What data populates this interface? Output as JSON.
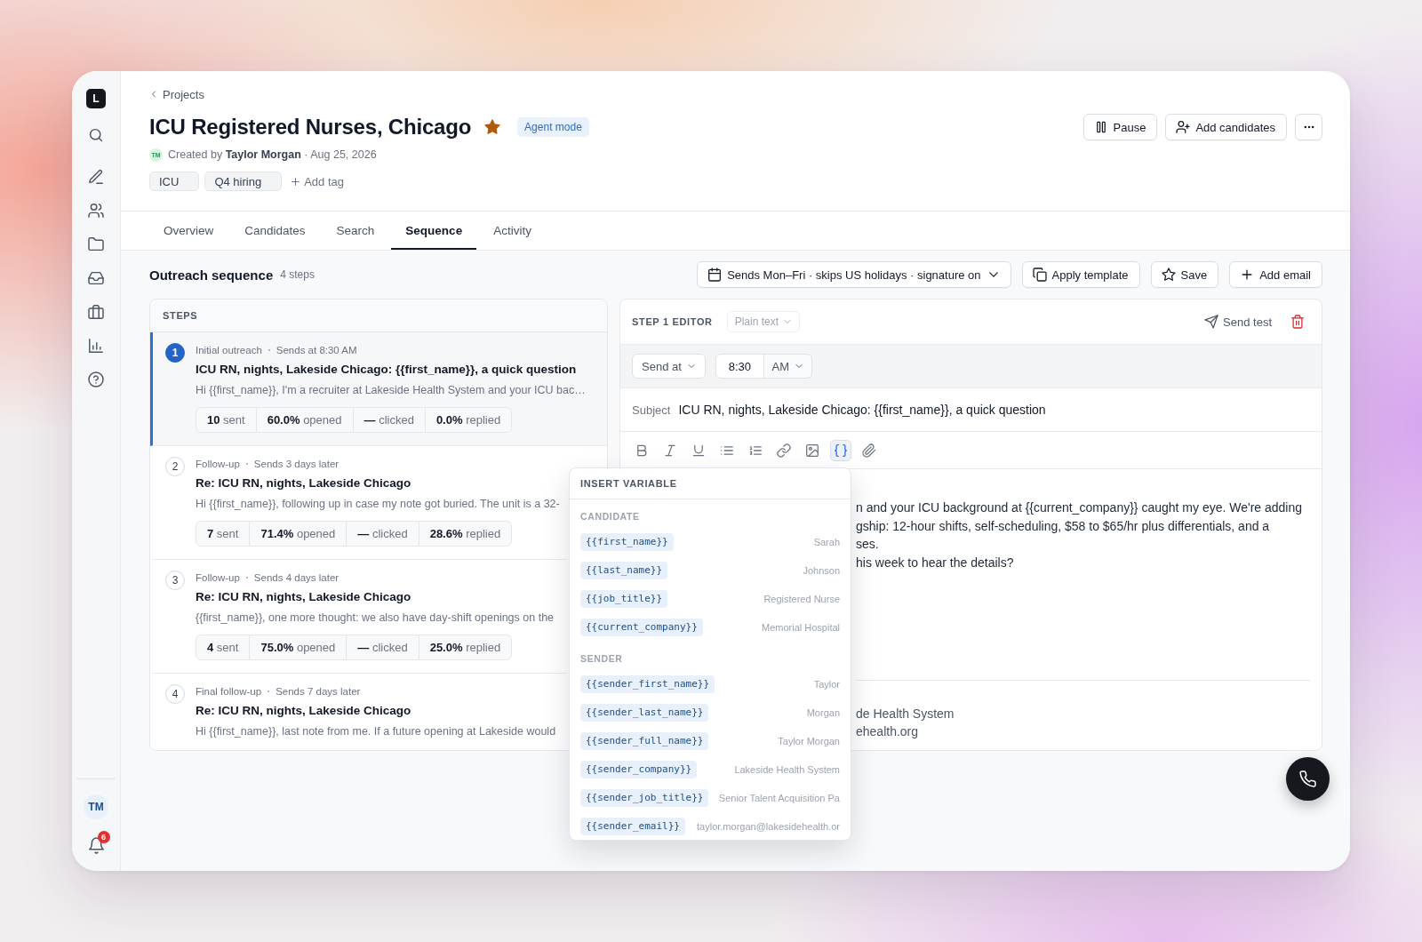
{
  "sidebar": {
    "logo": "L",
    "avatar": "TM",
    "notification_count": "6"
  },
  "breadcrumb": "Projects",
  "project": {
    "title": "ICU Registered Nurses, Chicago",
    "starred": true,
    "badge": "Agent mode",
    "creator_initials": "TM",
    "created": "Created by **Taylor Morgan** · Aug 25, 2026",
    "tags": [
      "ICU",
      "Q4 hiring"
    ],
    "add_tag": "Add tag"
  },
  "header_actions": [
    {
      "kind": "pause",
      "label": "Pause"
    },
    {
      "kind": "add-person",
      "label": "Add candidates"
    },
    {
      "kind": "more"
    }
  ],
  "tabs": [
    {
      "label": "Overview",
      "selected": false
    },
    {
      "label": "Candidates",
      "selected": false
    },
    {
      "label": "Search",
      "selected": false
    },
    {
      "label": "Sequence",
      "selected": true
    },
    {
      "label": "Activity",
      "selected": false
    }
  ],
  "sequence": {
    "title": "Outreach sequence",
    "count": "4 steps",
    "schedule": "Sends Mon–Fri · skips US holidays · signature on",
    "actions": [
      {
        "kind": "copy",
        "label": "Apply template"
      },
      {
        "kind": "star",
        "label": "Save"
      },
      {
        "kind": "plus",
        "label": "Add email"
      }
    ]
  },
  "steps_panel": {
    "heading": "STEPS",
    "steps": [
      {
        "number": "1",
        "selected": true,
        "type": "Initial outreach",
        "timing": "Sends at 8:30 AM",
        "subject": "ICU RN, nights, Lakeside Chicago: {{first_name}}, a quick question",
        "preview": "Hi {{first_name}}, I'm a recruiter at Lakeside Health System and your ICU bac…",
        "stats": [
          "**10** sent",
          "**60.0%** opened",
          "**—** clicked",
          "**0.0%** replied"
        ]
      },
      {
        "number": "2",
        "selected": false,
        "type": "Follow-up",
        "timing": "Sends 3 days later",
        "subject": "Re: ICU RN, nights, Lakeside Chicago",
        "preview": "Hi {{first_name}}, following up in case my note got buried. The unit is a 32-",
        "stats": [
          "**7** sent",
          "**71.4%** opened",
          "**—** clicked",
          "**28.6%** replied"
        ]
      },
      {
        "number": "3",
        "selected": false,
        "type": "Follow-up",
        "timing": "Sends 4 days later",
        "subject": "Re: ICU RN, nights, Lakeside Chicago",
        "preview": "{{first_name}}, one more thought: we also have day-shift openings on the",
        "stats": [
          "**4** sent",
          "**75.0%** opened",
          "**—** clicked",
          "**25.0%** replied"
        ]
      },
      {
        "number": "4",
        "selected": false,
        "type": "Final follow-up",
        "timing": "Sends 7 days later",
        "subject": "Re: ICU RN, nights, Lakeside Chicago",
        "preview": "Hi {{first_name}}, last note from me. If a future opening at Lakeside would"
      }
    ]
  },
  "editor": {
    "heading": "STEP 1 EDITOR",
    "format": "Plain text",
    "send_test": "Send test",
    "send_mode": "Send at",
    "time": "8:30",
    "meridiem": "AM",
    "subject_label": "Subject",
    "subject": "ICU RN, nights, Lakeside Chicago: {{first_name}}, a quick question",
    "toolbar": [
      {
        "kind": "bold",
        "selected": false
      },
      {
        "kind": "italic",
        "selected": false
      },
      {
        "kind": "underline",
        "selected": false
      },
      {
        "kind": "bullet-list",
        "selected": false
      },
      {
        "kind": "numbered-list",
        "selected": false
      },
      {
        "kind": "link",
        "selected": false
      },
      {
        "kind": "image",
        "selected": false
      },
      {
        "kind": "variable",
        "selected": true
      },
      {
        "kind": "attachment",
        "selected": false
      }
    ],
    "body_lines": [
      "n and your ICU background at {{current_company}} caught my eye. We're adding",
      "gship: 12-hour shifts, self-scheduling, $58 to $65/hr plus differentials, and a",
      "ses.",
      "his week to hear the details?"
    ],
    "signature_lines": [
      "de Health System",
      "ehealth.org"
    ]
  },
  "variable_menu": {
    "title": "INSERT VARIABLE",
    "groups": [
      {
        "label": "CANDIDATE",
        "items": [
          {
            "token": "{{first_name}}",
            "example": "Sarah"
          },
          {
            "token": "{{last_name}}",
            "example": "Johnson"
          },
          {
            "token": "{{job_title}}",
            "example": "Registered Nurse"
          },
          {
            "token": "{{current_company}}",
            "example": "Memorial Hospital"
          }
        ]
      },
      {
        "label": "SENDER",
        "items": [
          {
            "token": "{{sender_first_name}}",
            "example": "Taylor"
          },
          {
            "token": "{{sender_last_name}}",
            "example": "Morgan"
          },
          {
            "token": "{{sender_full_name}}",
            "example": "Taylor Morgan"
          },
          {
            "token": "{{sender_company}}",
            "example": "Lakeside Health System"
          },
          {
            "token": "{{sender_job_title}}",
            "example": "Senior Talent Acquisition Pa"
          },
          {
            "token": "{{sender_email}}",
            "example": "taylor.morgan@lakesidehealth.or"
          }
        ]
      }
    ]
  }
}
